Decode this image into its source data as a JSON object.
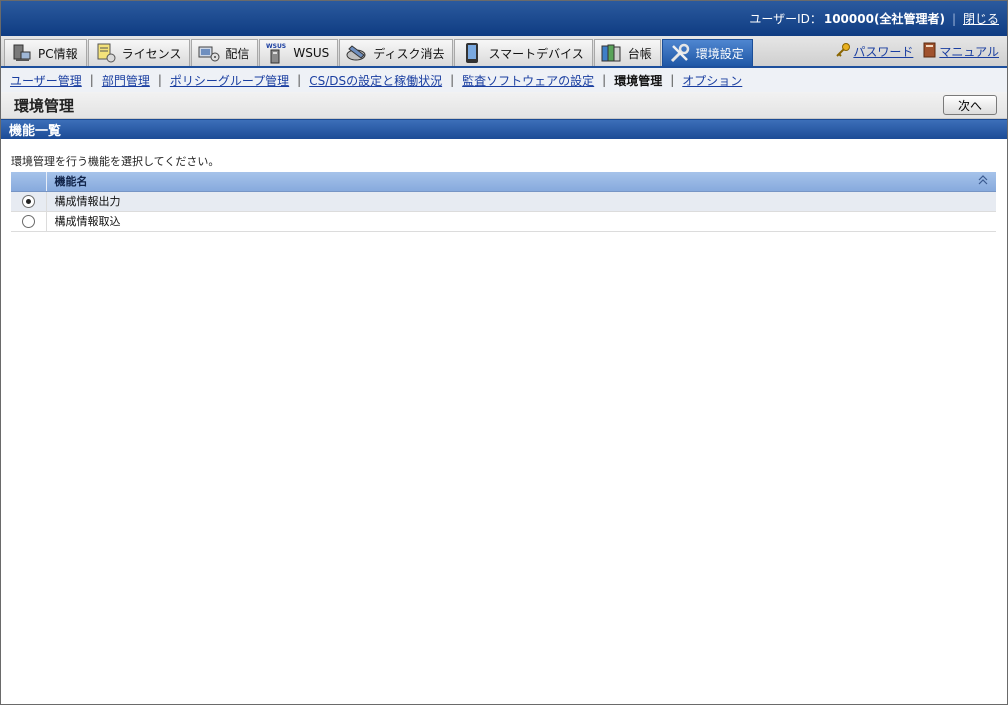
{
  "header": {
    "user_id_label": "ユーザーID：",
    "user_id_value": "100000(全社管理者)",
    "separator": "|",
    "logout_label": "閉じる"
  },
  "tabs": [
    {
      "label": "PC情報",
      "icon": "pc-icon"
    },
    {
      "label": "ライセンス",
      "icon": "license-icon"
    },
    {
      "label": "配信",
      "icon": "distribution-icon"
    },
    {
      "label": "WSUS",
      "icon": "wsus-icon"
    },
    {
      "label": "ディスク消去",
      "icon": "disk-erase-icon"
    },
    {
      "label": "スマートデバイス",
      "icon": "smart-device-icon"
    },
    {
      "label": "台帳",
      "icon": "ledger-icon"
    },
    {
      "label": "環境設定",
      "icon": "settings-tools-icon",
      "active": true
    }
  ],
  "right_links": {
    "password": "パスワード",
    "manual": "マニュアル"
  },
  "sub_nav": {
    "items": [
      "ユーザー管理",
      "部門管理",
      "ポリシーグループ管理",
      "CS/DSの設定と稼働状況",
      "監査ソフトウェアの設定",
      "環境管理",
      "オプション"
    ],
    "current_index": 5
  },
  "page": {
    "title": "環境管理",
    "next_button": "次へ"
  },
  "section": {
    "title": "機能一覧",
    "description": "環境管理を行う機能を選択してください。"
  },
  "table": {
    "header_name": "機能名",
    "rows": [
      {
        "name": "構成情報出力",
        "selected": true
      },
      {
        "name": "構成情報取込",
        "selected": false
      }
    ]
  },
  "colors": {
    "header_blue": "#0f3c82",
    "active_tab": "#1f57a6",
    "link": "#1a3ea0",
    "table_header": "#87aadd"
  }
}
